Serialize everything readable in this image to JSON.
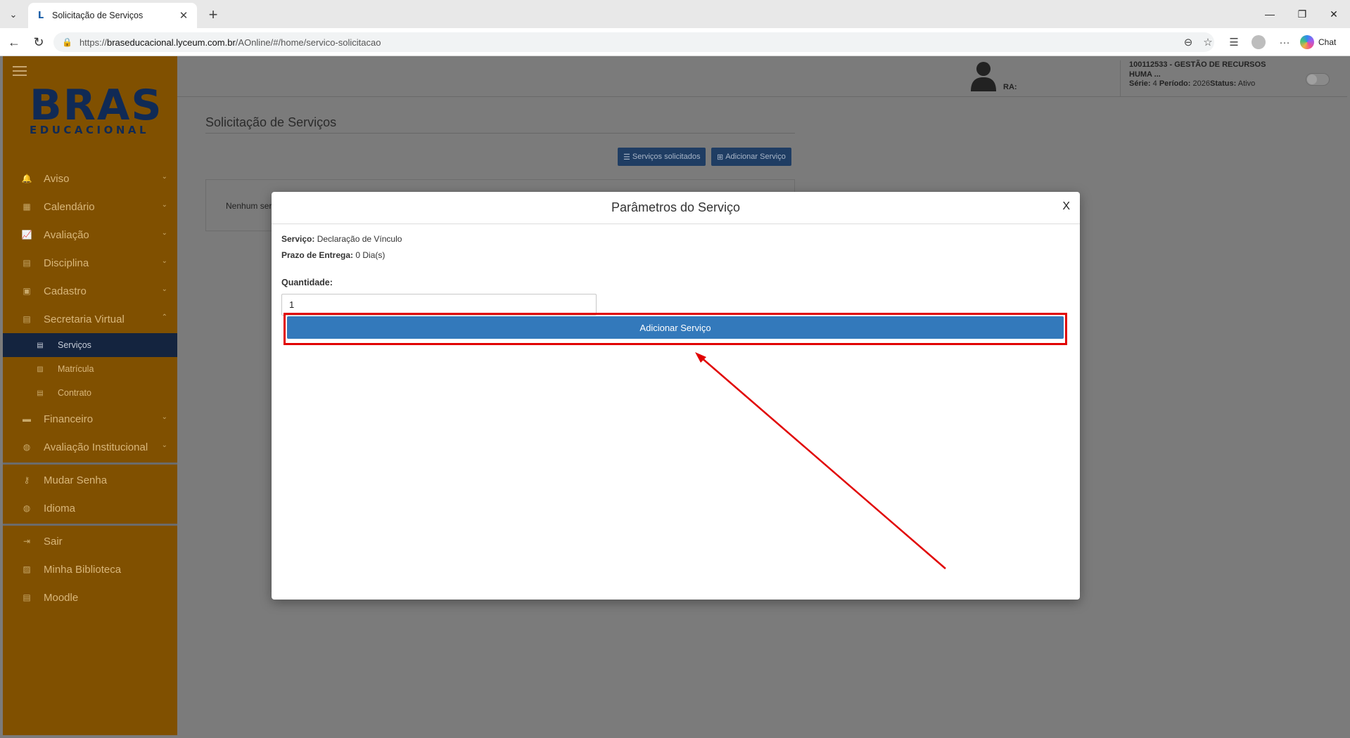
{
  "browser": {
    "tab_title": "Solicitação de Serviços",
    "tab_favicon": "L",
    "new_tab": "+",
    "url_prefix": "https://",
    "url_host": "braseducacional.lyceum.com.br",
    "url_path": "/AOnline/#/home/servico-solicitacao",
    "chat_label": "Chat",
    "minimize": "—",
    "restore": "❐",
    "close": "✕"
  },
  "logo": {
    "line1": "BRAS",
    "line2": "EDUCACIONAL"
  },
  "sidebar": {
    "items": [
      {
        "label": "Aviso",
        "icon": "bell-icon",
        "glyph": "🔔"
      },
      {
        "label": "Calendário",
        "icon": "calendar-icon",
        "glyph": "▦"
      },
      {
        "label": "Avaliação",
        "icon": "chart-icon",
        "glyph": "📈"
      },
      {
        "label": "Disciplina",
        "icon": "book-icon",
        "glyph": "▤"
      },
      {
        "label": "Cadastro",
        "icon": "id-card-icon",
        "glyph": "▣"
      },
      {
        "label": "Secretaria Virtual",
        "icon": "document-icon",
        "glyph": "▤"
      }
    ],
    "subitems": [
      {
        "label": "Serviços",
        "glyph": "▤"
      },
      {
        "label": "Matrícula",
        "glyph": "▨"
      },
      {
        "label": "Contrato",
        "glyph": "▤"
      }
    ],
    "items2": [
      {
        "label": "Financeiro",
        "icon": "money-icon",
        "glyph": "▬"
      },
      {
        "label": "Avaliação Institucional",
        "icon": "globe-icon",
        "glyph": "◍"
      }
    ],
    "items3": [
      {
        "label": "Mudar Senha",
        "icon": "key-icon",
        "glyph": "⚷"
      },
      {
        "label": "Idioma",
        "icon": "globe-icon",
        "glyph": "◍"
      }
    ],
    "items4": [
      {
        "label": "Sair",
        "icon": "logout-icon",
        "glyph": "⇥"
      },
      {
        "label": "Minha Biblioteca",
        "icon": "book-icon",
        "glyph": "▨"
      },
      {
        "label": "Moodle",
        "icon": "document-icon",
        "glyph": "▤"
      }
    ]
  },
  "header": {
    "ra_label": "RA:",
    "course_line": "100112533 - GESTÃO DE RECURSOS HUMA ...",
    "serie_label": "Série:",
    "serie_value": "4",
    "periodo_label": "Período:",
    "periodo_value": "2026",
    "status_label": "Status:",
    "status_value": "Ativo"
  },
  "page": {
    "title": "Solicitação de Serviços",
    "btn_requested": "Serviços solicitados",
    "btn_add": "Adicionar Serviço",
    "empty_text": "Nenhum ser"
  },
  "modal": {
    "title": "Parâmetros do Serviço",
    "close": "X",
    "service_label": "Serviço:",
    "service_value": "Declaração de Vínculo",
    "deadline_label": "Prazo de Entrega:",
    "deadline_value": "0 Dia(s)",
    "qty_label": "Quantidade:",
    "qty_value": "1",
    "add_button": "Adicionar Serviço"
  },
  "colors": {
    "sidebar": "#805000",
    "active_item": "#14243f",
    "primary_button": "#3379bb",
    "highlight": "#e10000"
  }
}
